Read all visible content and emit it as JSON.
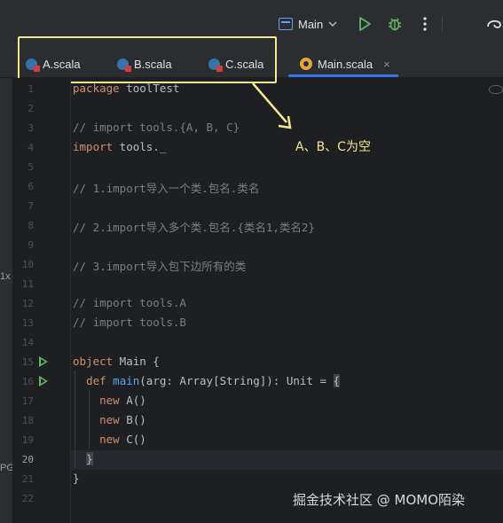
{
  "toolbar": {
    "run_config_label": "Main",
    "run_config_icon": "run-config-icon",
    "dropdown_icon": "chevron-down-icon",
    "run_icon": "run-icon",
    "debug_icon": "debug-icon",
    "more_icon": "more-vertical-icon",
    "accent_run": "#5fb865"
  },
  "tabs": [
    {
      "label": "A.scala",
      "icon": "scala-file-icon"
    },
    {
      "label": "B.scala",
      "icon": "scala-file-icon"
    },
    {
      "label": "C.scala",
      "icon": "scala-file-icon"
    },
    {
      "label": "Main.scala",
      "icon": "scala-object-icon",
      "active": true,
      "close": "×"
    }
  ],
  "left_strip": {
    "labels": [
      "1x",
      "PG"
    ]
  },
  "annotation": {
    "text": "A、B、C为空",
    "color": "#f2ea8f"
  },
  "watermark": "掘金技术社区 @ MOMO陌染",
  "editor": {
    "line_numbers": [
      "1",
      "2",
      "3",
      "4",
      "5",
      "6",
      "7",
      "8",
      "9",
      "10",
      "11",
      "12",
      "13",
      "14",
      "15",
      "16",
      "17",
      "18",
      "19",
      "20",
      "21",
      "22"
    ],
    "current_line": "20",
    "lines": [
      "package toolTest",
      "",
      "// import tools.{A, B, C}",
      "import tools._",
      "",
      "// 1.import导入一个类.包名.类名",
      "",
      "// 2.import导入多个类.包名.{类名1,类名2}",
      "",
      "// 3.import导入包下边所有的类",
      "",
      "// import tools.A",
      "// import tools.B",
      "",
      "object Main {",
      "  def main(arg: Array[String]): Unit = {",
      "    new A()",
      "    new B()",
      "    new C()",
      "  }",
      "}",
      ""
    ]
  }
}
